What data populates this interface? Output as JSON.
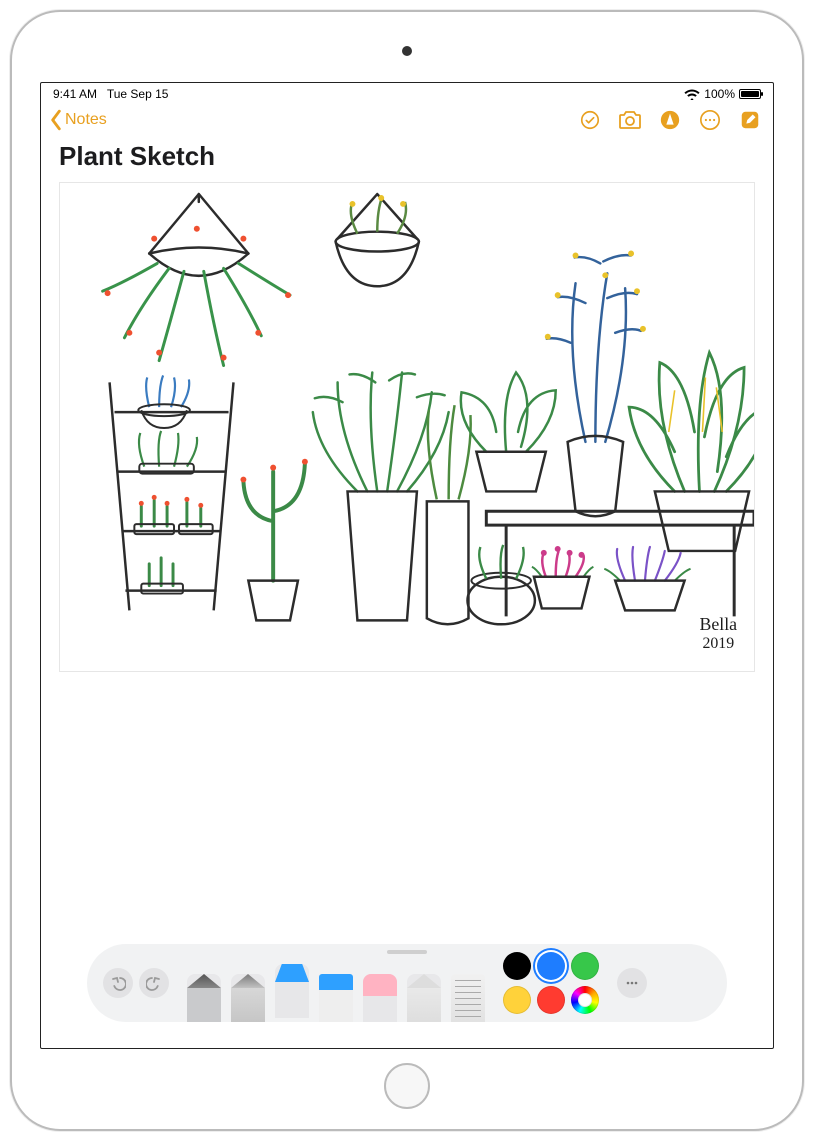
{
  "status": {
    "time": "9:41 AM",
    "date": "Tue Sep 15",
    "battery_percent": "100%"
  },
  "nav": {
    "back_label": "Notes"
  },
  "note": {
    "title": "Plant Sketch",
    "signature": "Bella",
    "signature_year": "2019"
  },
  "toolbar": {
    "tools": [
      "pen",
      "pencil",
      "marker",
      "highlighter",
      "eraser",
      "lasso",
      "ruler"
    ],
    "selected_tool": "marker",
    "colors": {
      "black": "#000000",
      "blue": "#1e7dff",
      "green": "#37c74a",
      "yellow": "#ffd23a",
      "red": "#ff3b30"
    },
    "selected_color": "blue"
  }
}
